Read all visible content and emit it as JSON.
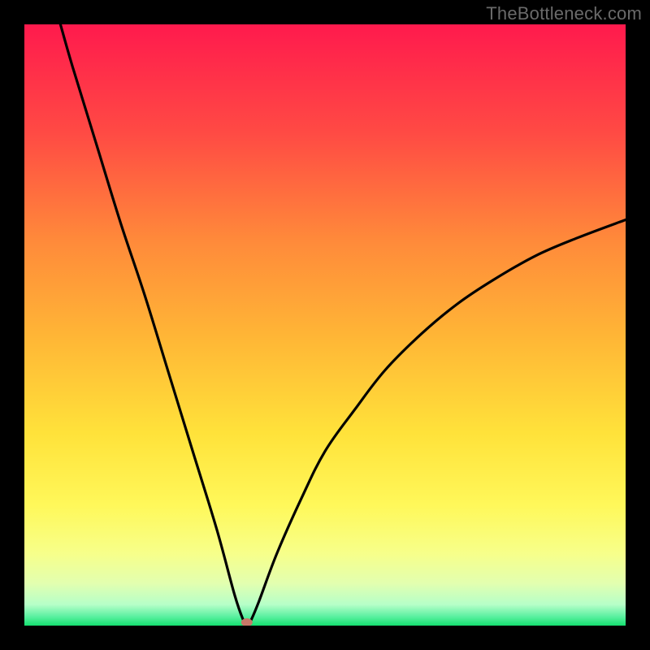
{
  "watermark": "TheBottleneck.com",
  "chart_data": {
    "type": "line",
    "title": "",
    "xlabel": "",
    "ylabel": "",
    "xlim": [
      0,
      100
    ],
    "ylim": [
      0,
      100
    ],
    "grid": false,
    "bottleneck_marker": {
      "x": 37,
      "y": 0,
      "color": "#c77869"
    },
    "gradient_stops": [
      {
        "offset": 0.0,
        "color": "#ff1a4d"
      },
      {
        "offset": 0.18,
        "color": "#ff4a44"
      },
      {
        "offset": 0.36,
        "color": "#ff8a3a"
      },
      {
        "offset": 0.52,
        "color": "#ffb636"
      },
      {
        "offset": 0.68,
        "color": "#ffe23a"
      },
      {
        "offset": 0.8,
        "color": "#fff85a"
      },
      {
        "offset": 0.88,
        "color": "#f7ff8a"
      },
      {
        "offset": 0.93,
        "color": "#e2ffb0"
      },
      {
        "offset": 0.965,
        "color": "#b6ffc8"
      },
      {
        "offset": 0.985,
        "color": "#5af0a0"
      },
      {
        "offset": 1.0,
        "color": "#15e070"
      }
    ],
    "series": [
      {
        "name": "bottleneck-curve",
        "points": [
          {
            "x": 6.0,
            "y": 100.0
          },
          {
            "x": 8.0,
            "y": 93.0
          },
          {
            "x": 12.0,
            "y": 80.0
          },
          {
            "x": 16.0,
            "y": 67.0
          },
          {
            "x": 20.0,
            "y": 55.0
          },
          {
            "x": 24.0,
            "y": 42.0
          },
          {
            "x": 28.0,
            "y": 29.0
          },
          {
            "x": 32.0,
            "y": 16.0
          },
          {
            "x": 35.0,
            "y": 5.0
          },
          {
            "x": 36.5,
            "y": 0.7
          },
          {
            "x": 37.0,
            "y": 0.0
          },
          {
            "x": 37.6,
            "y": 0.7
          },
          {
            "x": 39.0,
            "y": 4.0
          },
          {
            "x": 42.0,
            "y": 12.0
          },
          {
            "x": 46.0,
            "y": 21.0
          },
          {
            "x": 50.0,
            "y": 29.0
          },
          {
            "x": 55.0,
            "y": 36.0
          },
          {
            "x": 60.0,
            "y": 42.5
          },
          {
            "x": 66.0,
            "y": 48.5
          },
          {
            "x": 72.0,
            "y": 53.5
          },
          {
            "x": 78.0,
            "y": 57.5
          },
          {
            "x": 85.0,
            "y": 61.5
          },
          {
            "x": 92.0,
            "y": 64.5
          },
          {
            "x": 100.0,
            "y": 67.5
          }
        ]
      }
    ]
  }
}
